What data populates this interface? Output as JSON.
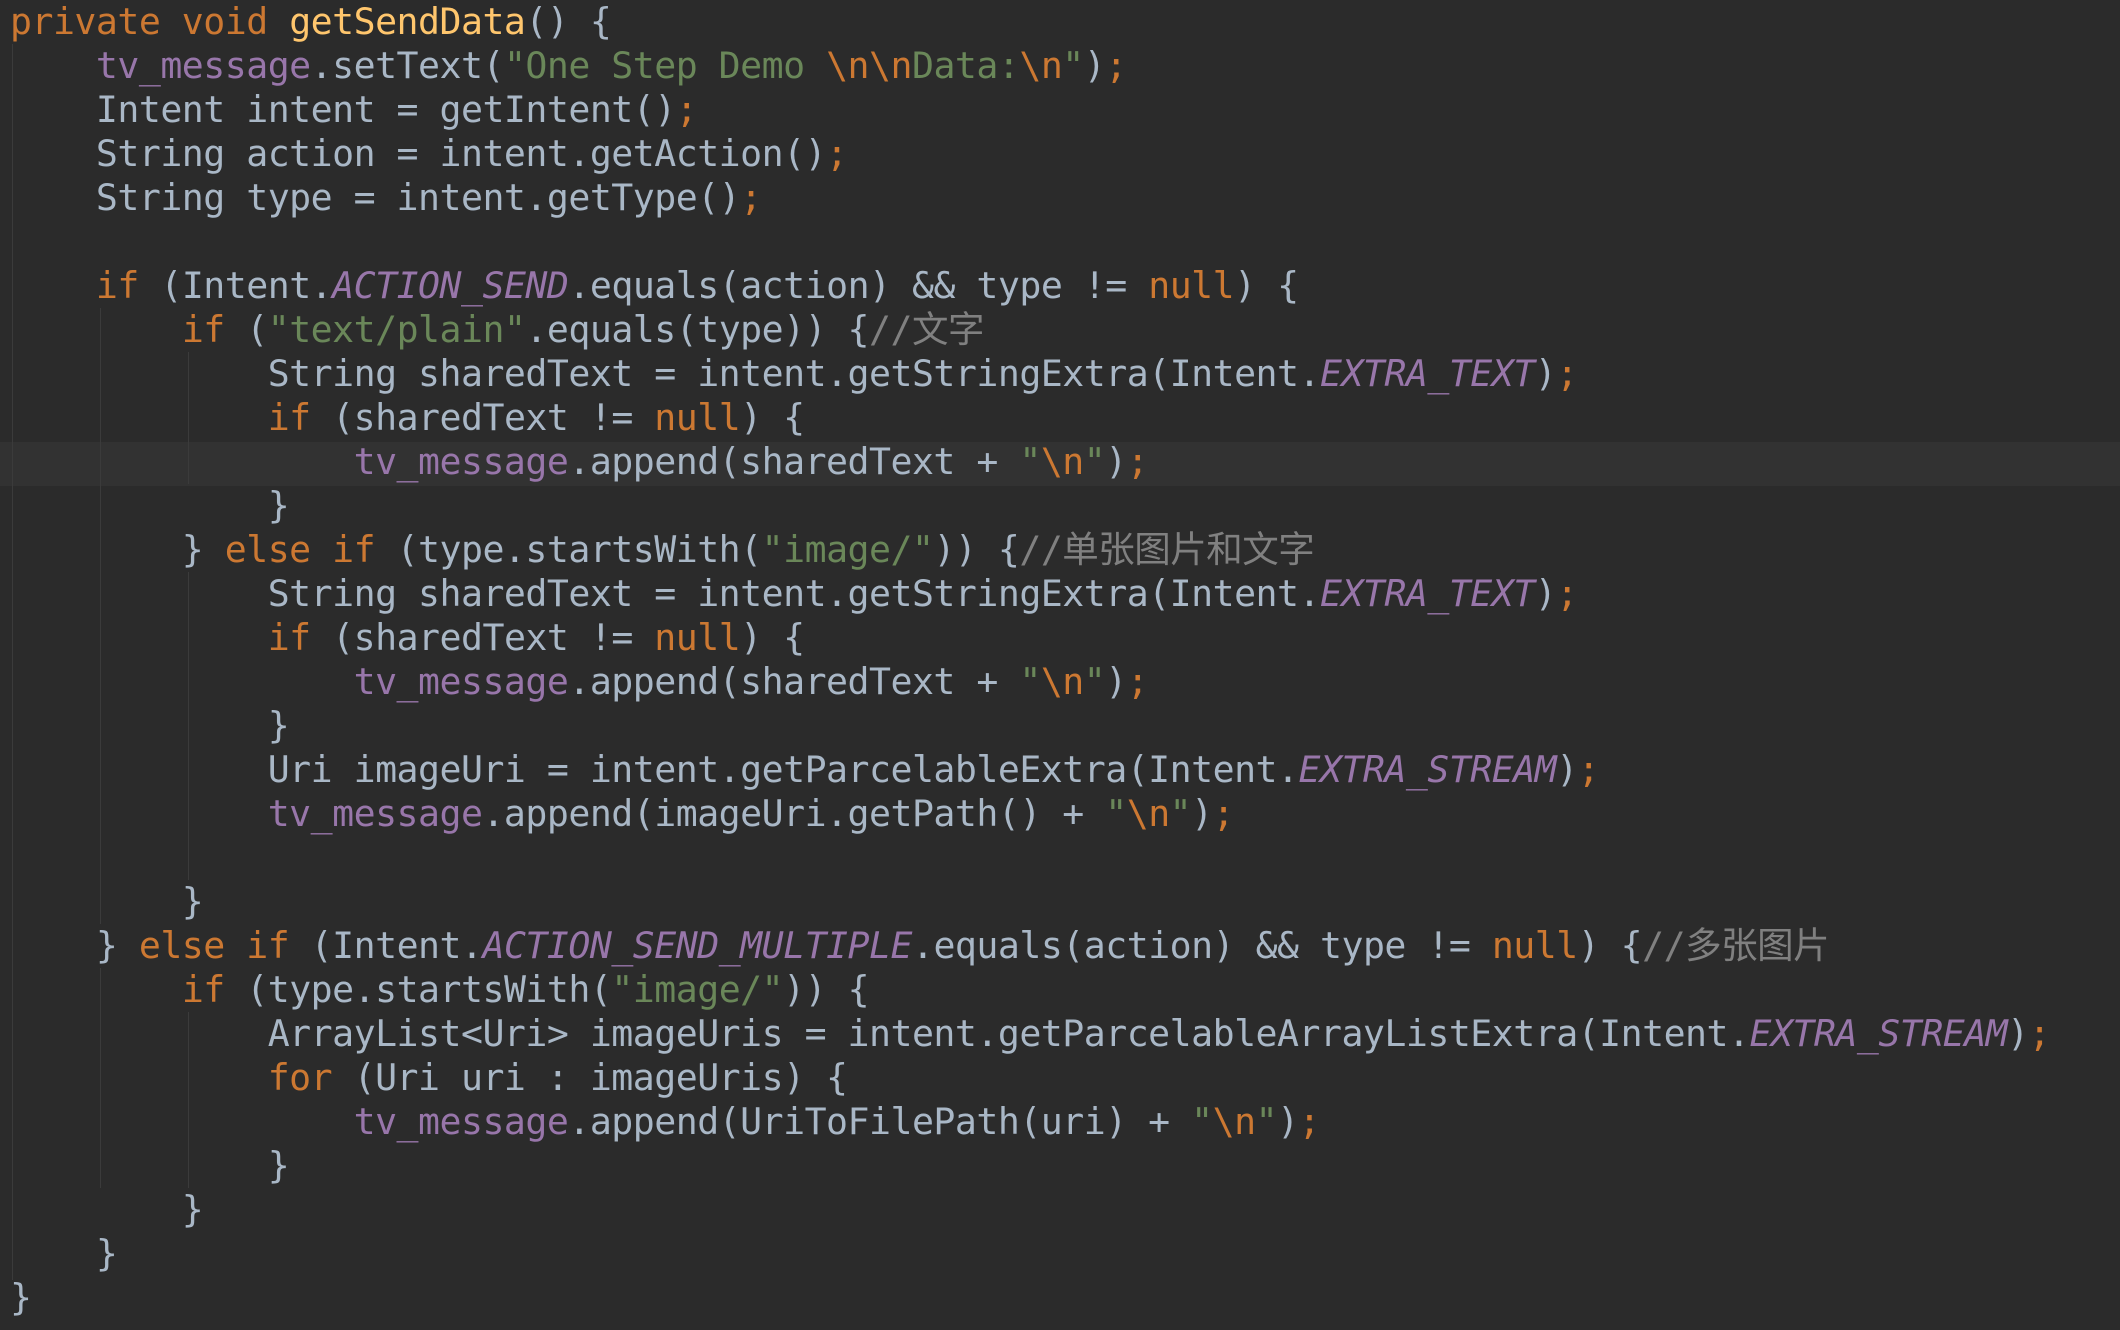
{
  "editor": {
    "colors": {
      "background": "#2b2b2b",
      "caret_row": "#323232",
      "default": "#a9b7c6",
      "keyword": "#cc7832",
      "method_declaration": "#ffc66d",
      "string": "#6a8759",
      "field": "#9876aa",
      "constant": "#9876aa",
      "comment": "#808080"
    },
    "lines": [
      [
        [
          "kw",
          "private void "
        ],
        [
          "fn",
          "getSendData"
        ],
        [
          "t",
          "() {"
        ]
      ],
      [
        [
          "t",
          "    "
        ],
        [
          "fld",
          "tv_message"
        ],
        [
          "t",
          ".setText("
        ],
        [
          "str",
          "\"One Step Demo "
        ],
        [
          "esc",
          "\\n\\n"
        ],
        [
          "str",
          "Data:"
        ],
        [
          "esc",
          "\\n"
        ],
        [
          "str",
          "\""
        ],
        [
          "t",
          ")"
        ],
        [
          "kw",
          ";"
        ]
      ],
      [
        [
          "t",
          "    Intent intent = getIntent()"
        ],
        [
          "kw",
          ";"
        ]
      ],
      [
        [
          "t",
          "    String action = intent.getAction()"
        ],
        [
          "kw",
          ";"
        ]
      ],
      [
        [
          "t",
          "    String type = intent.getType()"
        ],
        [
          "kw",
          ";"
        ]
      ],
      [],
      [
        [
          "t",
          "    "
        ],
        [
          "kw",
          "if "
        ],
        [
          "t",
          "(Intent."
        ],
        [
          "cst",
          "ACTION_SEND"
        ],
        [
          "t",
          ".equals(action) && type != "
        ],
        [
          "kw",
          "null"
        ],
        [
          "t",
          ") {"
        ]
      ],
      [
        [
          "t",
          "        "
        ],
        [
          "kw",
          "if "
        ],
        [
          "t",
          "("
        ],
        [
          "str",
          "\"text/plain\""
        ],
        [
          "t",
          ".equals(type)) {"
        ],
        [
          "cmt",
          "//文字"
        ]
      ],
      [
        [
          "t",
          "            String sharedText = intent.getStringExtra(Intent."
        ],
        [
          "cst",
          "EXTRA_TEXT"
        ],
        [
          "t",
          ")"
        ],
        [
          "kw",
          ";"
        ]
      ],
      [
        [
          "t",
          "            "
        ],
        [
          "kw",
          "if "
        ],
        [
          "t",
          "(sharedText != "
        ],
        [
          "kw",
          "null"
        ],
        [
          "t",
          ") {"
        ]
      ],
      [
        [
          "t",
          "                "
        ],
        [
          "fld",
          "tv_message"
        ],
        [
          "t",
          ".append(sharedText + "
        ],
        [
          "str",
          "\""
        ],
        [
          "esc",
          "\\n"
        ],
        [
          "str",
          "\""
        ],
        [
          "t",
          ")"
        ],
        [
          "kw",
          ";"
        ]
      ],
      [
        [
          "t",
          "            }"
        ]
      ],
      [
        [
          "t",
          "        } "
        ],
        [
          "kw",
          "else if "
        ],
        [
          "t",
          "(type.startsWith("
        ],
        [
          "str",
          "\"image/\""
        ],
        [
          "t",
          ")) {"
        ],
        [
          "cmt",
          "//单张图片和文字"
        ]
      ],
      [
        [
          "t",
          "            String sharedText = intent.getStringExtra(Intent."
        ],
        [
          "cst",
          "EXTRA_TEXT"
        ],
        [
          "t",
          ")"
        ],
        [
          "kw",
          ";"
        ]
      ],
      [
        [
          "t",
          "            "
        ],
        [
          "kw",
          "if "
        ],
        [
          "t",
          "(sharedText != "
        ],
        [
          "kw",
          "null"
        ],
        [
          "t",
          ") {"
        ]
      ],
      [
        [
          "t",
          "                "
        ],
        [
          "fld",
          "tv_message"
        ],
        [
          "t",
          ".append(sharedText + "
        ],
        [
          "str",
          "\""
        ],
        [
          "esc",
          "\\n"
        ],
        [
          "str",
          "\""
        ],
        [
          "t",
          ")"
        ],
        [
          "kw",
          ";"
        ]
      ],
      [
        [
          "t",
          "            }"
        ]
      ],
      [
        [
          "t",
          "            Uri imageUri = intent.getParcelableExtra(Intent."
        ],
        [
          "cst",
          "EXTRA_STREAM"
        ],
        [
          "t",
          ")"
        ],
        [
          "kw",
          ";"
        ]
      ],
      [
        [
          "t",
          "            "
        ],
        [
          "fld",
          "tv_message"
        ],
        [
          "t",
          ".append(imageUri.getPath() + "
        ],
        [
          "str",
          "\""
        ],
        [
          "esc",
          "\\n"
        ],
        [
          "str",
          "\""
        ],
        [
          "t",
          ")"
        ],
        [
          "kw",
          ";"
        ]
      ],
      [],
      [
        [
          "t",
          "        }"
        ]
      ],
      [
        [
          "t",
          "    } "
        ],
        [
          "kw",
          "else if "
        ],
        [
          "t",
          "(Intent."
        ],
        [
          "cst",
          "ACTION_SEND_MULTIPLE"
        ],
        [
          "t",
          ".equals(action) && type != "
        ],
        [
          "kw",
          "null"
        ],
        [
          "t",
          ") {"
        ],
        [
          "cmt",
          "//多张图片"
        ]
      ],
      [
        [
          "t",
          "        "
        ],
        [
          "kw",
          "if "
        ],
        [
          "t",
          "(type.startsWith("
        ],
        [
          "str",
          "\"image/\""
        ],
        [
          "t",
          ")) {"
        ]
      ],
      [
        [
          "t",
          "            ArrayList<Uri> imageUris = intent.getParcelableArrayListExtra(Intent."
        ],
        [
          "cst",
          "EXTRA_STREAM"
        ],
        [
          "t",
          ")"
        ],
        [
          "kw",
          ";"
        ]
      ],
      [
        [
          "t",
          "            "
        ],
        [
          "kw",
          "for "
        ],
        [
          "t",
          "(Uri uri : imageUris) {"
        ]
      ],
      [
        [
          "t",
          "                "
        ],
        [
          "fld",
          "tv_message"
        ],
        [
          "t",
          ".append(UriToFilePath(uri) + "
        ],
        [
          "str",
          "\""
        ],
        [
          "esc",
          "\\n"
        ],
        [
          "str",
          "\""
        ],
        [
          "t",
          ")"
        ],
        [
          "kw",
          ";"
        ]
      ],
      [
        [
          "t",
          "            }"
        ]
      ],
      [
        [
          "t",
          "        }"
        ]
      ],
      [
        [
          "t",
          "    }"
        ]
      ],
      [
        [
          "t",
          "}"
        ]
      ]
    ]
  }
}
